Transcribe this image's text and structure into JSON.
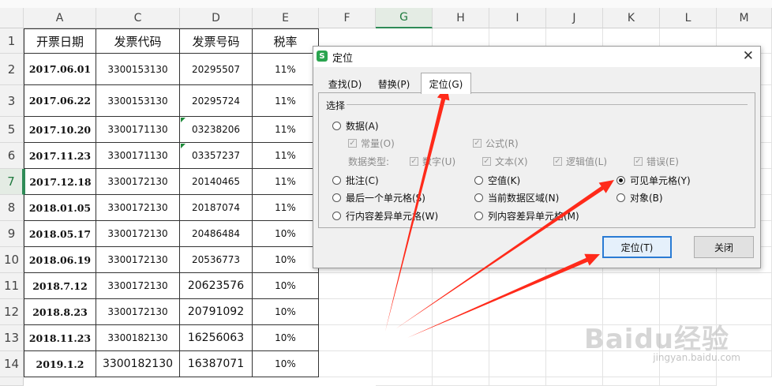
{
  "sheet": {
    "columns": [
      "A",
      "C",
      "D",
      "E",
      "F",
      "G",
      "H",
      "I",
      "J",
      "K",
      "L",
      "M"
    ],
    "selected_column": "G",
    "header_row": {
      "row": "1",
      "cells": [
        "开票日期",
        "发票代码",
        "发票号码",
        "税率"
      ]
    },
    "rows": [
      {
        "row": "2",
        "date": "2017.06.01",
        "code": "3300153130",
        "number": "20295507",
        "rate": "11%"
      },
      {
        "row": "3",
        "date": "2017.06.22",
        "code": "3300153130",
        "number": "20295724",
        "rate": "11%"
      },
      {
        "row": "5",
        "date": "2017.10.20",
        "code": "3300171130",
        "number": "03238206",
        "rate": "11%"
      },
      {
        "row": "6",
        "date": "2017.11.23",
        "code": "3300171130",
        "number": "03357237",
        "rate": "11%"
      },
      {
        "row": "7",
        "date": "2017.12.18",
        "code": "3300172130",
        "number": "20140465",
        "rate": "11%"
      },
      {
        "row": "8",
        "date": "2018.01.05",
        "code": "3300172130",
        "number": "20187074",
        "rate": "11%"
      },
      {
        "row": "9",
        "date": "2018.05.17",
        "code": "3300172130",
        "number": "20486484",
        "rate": "10%"
      },
      {
        "row": "10",
        "date": "2018.06.19",
        "code": "3300172130",
        "number": "20536773",
        "rate": "10%"
      },
      {
        "row": "11",
        "date": "2018.7.12",
        "code": "3300172130",
        "number": "20623576",
        "rate": "10%"
      },
      {
        "row": "12",
        "date": "2018.8.23",
        "code": "3300172130",
        "number": "20791092",
        "rate": "10%"
      },
      {
        "row": "13",
        "date": "2018.11.23",
        "code": "3300182130",
        "number": "16256063",
        "rate": "10%"
      },
      {
        "row": "14",
        "date": "2019.1.2",
        "code": "3300182130",
        "number": "16387071",
        "rate": "10%"
      }
    ],
    "selected_row": "7"
  },
  "dialog": {
    "icon_letter": "S",
    "title": "定位",
    "close": "✕",
    "tabs": [
      "查找(D)",
      "替换(P)",
      "定位(G)"
    ],
    "active_tab": "定位(G)",
    "group_label": "选择",
    "options": {
      "data": "数据(A)",
      "constant": "常量(O)",
      "formula": "公式(R)",
      "data_type_label": "数据类型:",
      "number": "数字(U)",
      "text": "文本(X)",
      "logical": "逻辑值(L)",
      "error": "错误(E)",
      "comment": "批注(C)",
      "blank": "空值(K)",
      "visible_cells": "可见单元格(Y)",
      "last_cell": "最后一个单元格(S)",
      "current_region": "当前数据区域(N)",
      "object": "对象(B)",
      "row_diff": "行内容差异单元格(W)",
      "col_diff": "列内容差异单元格(M)"
    },
    "selected_option": "可见单元格(Y)",
    "buttons": {
      "goto": "定位(T)",
      "close": "关闭"
    }
  },
  "annotation": {
    "arrow_color": "#ff2a1a"
  },
  "watermark": {
    "text": "Baidu经验",
    "sub": "jingyan.baidu.com"
  }
}
